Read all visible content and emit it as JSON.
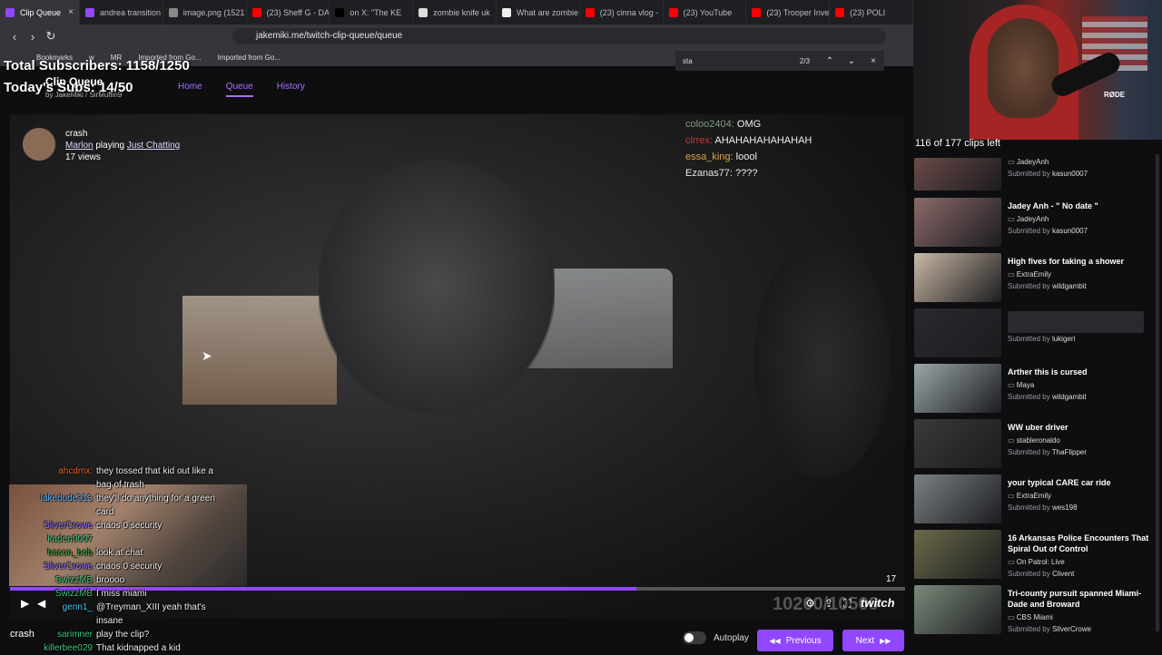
{
  "browser": {
    "tabs": [
      {
        "label": "Clip Queue",
        "active": true,
        "color": "#9147ff"
      },
      {
        "label": "andrea transition",
        "color": "#9147ff"
      },
      {
        "label": "image.png (1521",
        "color": "#888888"
      },
      {
        "label": "(23) Sheff G - DA",
        "color": "#ff0000"
      },
      {
        "label": "on X: \"The KE",
        "color": "#000000"
      },
      {
        "label": "zombie knife uk",
        "color": "#dddddd"
      },
      {
        "label": "What are zombie",
        "color": "#eeeeee"
      },
      {
        "label": "(23) cinna vlog -",
        "color": "#ff0000"
      },
      {
        "label": "(23) YouTube",
        "color": "#ff0000"
      },
      {
        "label": "(23) Trooper Inve",
        "color": "#ff0000"
      },
      {
        "label": "(23) POLI",
        "color": "#ff0000"
      }
    ],
    "close_glyph": "×",
    "back_glyph": "‹",
    "forward_glyph": "›",
    "reload_glyph": "↻",
    "url": "jakemiki.me/twitch-clip-queue/queue",
    "bookmarks": [
      "Bookmarks",
      "w",
      "MR",
      "Imported from Go...",
      "Imported from Go..."
    ],
    "find": {
      "query": "sta",
      "count": "2/3",
      "up": "⌃",
      "down": "⌄",
      "close": "×"
    }
  },
  "overlay": {
    "total_subs": "Total Subscribers: 1158/1250",
    "today_subs": "Today's Subs: 14/50"
  },
  "app": {
    "name": "Clip Queue",
    "by": "by JakeMiki / SirMuffin9",
    "nav": [
      "Home",
      "Queue",
      "History"
    ]
  },
  "clip": {
    "title": "crash",
    "creator": "Marlon",
    "playing": "playing",
    "category": "Just Chatting",
    "views": "17 views",
    "progress": 0.7,
    "counter": "17",
    "bignum": "10200/10500",
    "brand": "twitch"
  },
  "video_chat": [
    {
      "user": "coloo2404:",
      "msg": "OMG",
      "color": "#7f9f7f"
    },
    {
      "user": "clrrex:",
      "msg": "AHAHAHAHAHAHAH",
      "color": "#c23b3b"
    },
    {
      "user": "essa_king:",
      "msg": "loool",
      "color": "#d6a54a"
    },
    {
      "user": "Ezanas77:",
      "msg": "????",
      "color": "#e8e8e8"
    }
  ],
  "stream_chat": [
    {
      "user": "ahcdmx:",
      "msg": "they tossed that kid out like a",
      "color": "#e06c2b"
    },
    {
      "user": "",
      "msg": "bag of trash",
      "color": "#ffffff"
    },
    {
      "user": "lakedude313",
      "msg": "they'll do anything for a green",
      "color": "#59b4ff"
    },
    {
      "user": "",
      "msg": "card",
      "color": "#ffffff"
    },
    {
      "user": "SilverCrowe",
      "msg": "chaos 0 security",
      "color": "#8a6bff"
    },
    {
      "user": "kaden0007",
      "msg": "",
      "color": "#3cc47b"
    },
    {
      "user": "bacon_bob",
      "msg": "look at chat",
      "color": "#3a9a3a"
    },
    {
      "user": "SilverCrowe",
      "msg": "chaos 0 security",
      "color": "#8a6bff"
    },
    {
      "user": "SwizzMB",
      "msg": "broooo",
      "color": "#3cc47b"
    },
    {
      "user": "SwizzMB",
      "msg": "I miss miami",
      "color": "#3cc47b"
    },
    {
      "user": "genn1_",
      "msg": "@Treyman_XIII yeah that's",
      "color": "#4fc3f7"
    },
    {
      "user": "",
      "msg": "insane",
      "color": "#ffffff"
    },
    {
      "user": "sarimner",
      "msg": "play the clip?",
      "color": "#3cc47b"
    },
    {
      "user": "killerbee029",
      "msg": "That kidnapped a kid",
      "color": "#3cc47b"
    }
  ],
  "controls": {
    "play": "▶",
    "volume": "◀",
    "settings": "⚙",
    "share": "⇪",
    "fullscreen": "⛶",
    "crash_label": "crash",
    "autoplay_label": "Autoplay",
    "previous_label": "Previous",
    "next_label": "Next",
    "prev_icon": "◀◀",
    "next_icon": "▶▶"
  },
  "queue": {
    "count_text": "116 of 177 clips left",
    "items": [
      {
        "title": "",
        "creator": "JadeyAnh",
        "submitted": "kasun0007",
        "thumb": "#6b4a4a"
      },
      {
        "title": "Jadey Anh - \" No date \"",
        "creator": "JadeyAnh",
        "submitted": "kasun0007",
        "thumb": "#8a6a6a"
      },
      {
        "title": "High fives for taking a shower",
        "creator": "ExtraEmily",
        "submitted": "wildgambit",
        "thumb": "#c9b8a6"
      },
      {
        "title": "",
        "creator": "",
        "submitted": "lukigeri",
        "thumb": "#2a2a2e",
        "placeholder": true
      },
      {
        "title": "Arther this is cursed",
        "creator": "Maya",
        "submitted": "wildgambit",
        "thumb": "#9aa6a8"
      },
      {
        "title": "WW uber driver",
        "creator": "stableronaldo",
        "submitted": "ThaFlipper",
        "thumb": "#3a3a3a"
      },
      {
        "title": "your typical CARE car ride",
        "creator": "ExtraEmily",
        "submitted": "wes198",
        "thumb": "#7a8282"
      },
      {
        "title": "16 Arkansas Police Encounters That Spiral Out of Control",
        "creator": "On Patrol: Live",
        "submitted": "Clivent",
        "thumb": "#6a6a4a"
      },
      {
        "title": "Tri-county pursuit spanned Miami-Dade and Broward",
        "creator": "CBS Miami",
        "submitted": "SilverCrowe",
        "thumb": "#7a8a7a"
      }
    ],
    "submitted_prefix": "Submitted by"
  },
  "webcam": {
    "mic_text": "RØDE"
  }
}
